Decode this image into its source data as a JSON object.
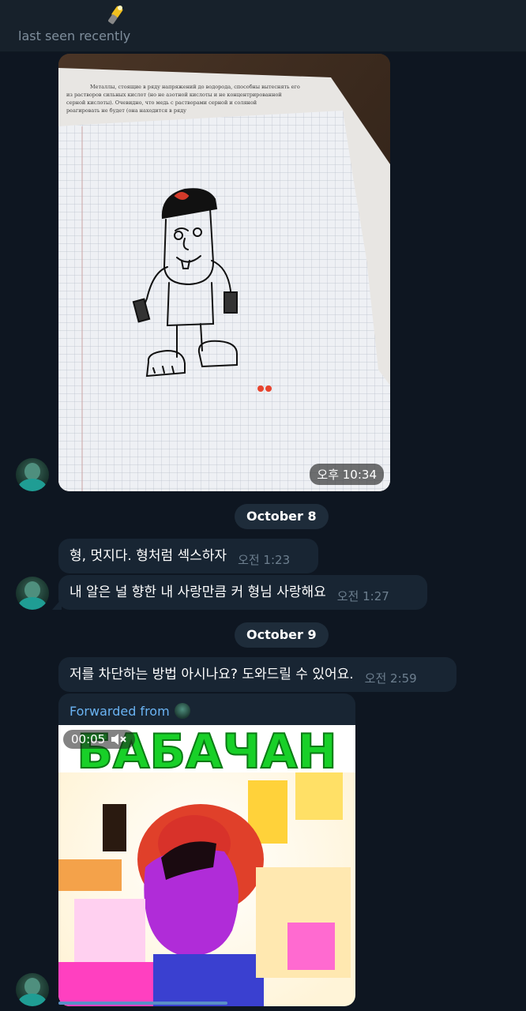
{
  "header": {
    "status": "last seen recently",
    "emoji_icon": "flashlight-emoji-icon"
  },
  "photo_message": {
    "time": "오후 10:34",
    "image_description_icon": "photo-drawing-on-graph-paper",
    "printed_text": [
      "Металлы, стоящие в ряду напряжений до водорода, способны вытеснять его",
      "из растворов сильных кислот (но не азотной кислоты и не концентрированной",
      "серной кислоты). Очевидно, что медь с растворами серной и соляной",
      "реагировать не будет (она находится в ряду"
    ]
  },
  "dates": {
    "oct8": "October 8",
    "oct9": "October 9"
  },
  "messages": [
    {
      "text": "형, 멋지다. 형처럼 섹스하자",
      "time": "오전 1:23"
    },
    {
      "text": "내 알은 널 향한 내 사랑만큼 커 형님 사랑해요",
      "time": "오전 1:27"
    },
    {
      "text": "저를 차단하는 방법 아시나요? 도와드릴 수 있어요.",
      "time": "오전 2:59"
    }
  ],
  "forwarded": {
    "label": "Forwarded from",
    "video_time": "00:05",
    "mute_icon": "speaker-muted-icon",
    "video_caption": "БАБАЧАН",
    "playback_fraction": 0.57
  },
  "colors": {
    "background": "#0e1621",
    "bubble": "#182533",
    "link": "#6ab3f3",
    "date_pill": "#1e2c3a"
  }
}
